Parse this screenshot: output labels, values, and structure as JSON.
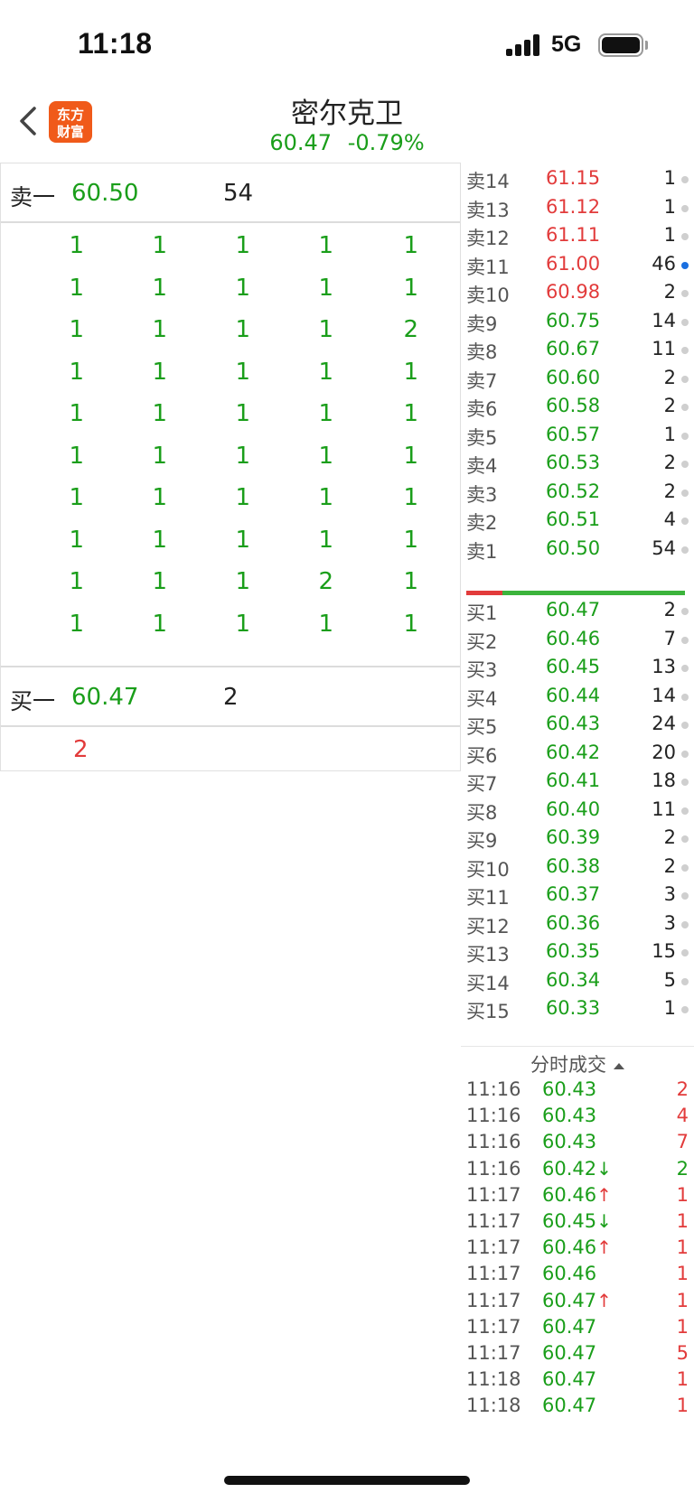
{
  "status_bar": {
    "time": "11:18",
    "network": "5G"
  },
  "header": {
    "logo_text": "东方财富",
    "stock_name": "密尔克卫",
    "price": "60.47",
    "change_pct": "-0.79%"
  },
  "left_panel": {
    "sell_level": {
      "label": "卖一",
      "price": "60.50",
      "volume": "54"
    },
    "sell_queue": [
      [
        "1",
        "1",
        "1",
        "1",
        "1"
      ],
      [
        "1",
        "1",
        "1",
        "1",
        "1"
      ],
      [
        "1",
        "1",
        "1",
        "1",
        "2"
      ],
      [
        "1",
        "1",
        "1",
        "1",
        "1"
      ],
      [
        "1",
        "1",
        "1",
        "1",
        "1"
      ],
      [
        "1",
        "1",
        "1",
        "1",
        "1"
      ],
      [
        "1",
        "1",
        "1",
        "1",
        "1"
      ],
      [
        "1",
        "1",
        "1",
        "1",
        "1"
      ],
      [
        "1",
        "1",
        "1",
        "2",
        "1"
      ],
      [
        "1",
        "1",
        "1",
        "1",
        "1"
      ]
    ],
    "buy_level": {
      "label": "买一",
      "price": "60.47",
      "volume": "2"
    },
    "buy_queue": [
      "2"
    ]
  },
  "order_book": {
    "asks": [
      {
        "label": "卖14",
        "price": "61.15",
        "volume": "1",
        "color": "red",
        "dot": "gray"
      },
      {
        "label": "卖13",
        "price": "61.12",
        "volume": "1",
        "color": "red",
        "dot": "gray"
      },
      {
        "label": "卖12",
        "price": "61.11",
        "volume": "1",
        "color": "red",
        "dot": "gray"
      },
      {
        "label": "卖11",
        "price": "61.00",
        "volume": "46",
        "color": "red",
        "dot": "blue"
      },
      {
        "label": "卖10",
        "price": "60.98",
        "volume": "2",
        "color": "red",
        "dot": "gray"
      },
      {
        "label": "卖9",
        "price": "60.75",
        "volume": "14",
        "color": "green",
        "dot": "gray"
      },
      {
        "label": "卖8",
        "price": "60.67",
        "volume": "11",
        "color": "green",
        "dot": "gray"
      },
      {
        "label": "卖7",
        "price": "60.60",
        "volume": "2",
        "color": "green",
        "dot": "gray"
      },
      {
        "label": "卖6",
        "price": "60.58",
        "volume": "2",
        "color": "green",
        "dot": "gray"
      },
      {
        "label": "卖5",
        "price": "60.57",
        "volume": "1",
        "color": "green",
        "dot": "gray"
      },
      {
        "label": "卖4",
        "price": "60.53",
        "volume": "2",
        "color": "green",
        "dot": "gray"
      },
      {
        "label": "卖3",
        "price": "60.52",
        "volume": "2",
        "color": "green",
        "dot": "gray"
      },
      {
        "label": "卖2",
        "price": "60.51",
        "volume": "4",
        "color": "green",
        "dot": "gray"
      },
      {
        "label": "卖1",
        "price": "60.50",
        "volume": "54",
        "color": "green",
        "dot": "gray"
      }
    ],
    "bids": [
      {
        "label": "买1",
        "price": "60.47",
        "volume": "2",
        "color": "green",
        "dot": "gray"
      },
      {
        "label": "买2",
        "price": "60.46",
        "volume": "7",
        "color": "green",
        "dot": "gray"
      },
      {
        "label": "买3",
        "price": "60.45",
        "volume": "13",
        "color": "green",
        "dot": "gray"
      },
      {
        "label": "买4",
        "price": "60.44",
        "volume": "14",
        "color": "green",
        "dot": "gray"
      },
      {
        "label": "买5",
        "price": "60.43",
        "volume": "24",
        "color": "green",
        "dot": "gray"
      },
      {
        "label": "买6",
        "price": "60.42",
        "volume": "20",
        "color": "green",
        "dot": "gray"
      },
      {
        "label": "买7",
        "price": "60.41",
        "volume": "18",
        "color": "green",
        "dot": "gray"
      },
      {
        "label": "买8",
        "price": "60.40",
        "volume": "11",
        "color": "green",
        "dot": "gray"
      },
      {
        "label": "买9",
        "price": "60.39",
        "volume": "2",
        "color": "green",
        "dot": "gray"
      },
      {
        "label": "买10",
        "price": "60.38",
        "volume": "2",
        "color": "green",
        "dot": "gray"
      },
      {
        "label": "买11",
        "price": "60.37",
        "volume": "3",
        "color": "green",
        "dot": "gray"
      },
      {
        "label": "买12",
        "price": "60.36",
        "volume": "3",
        "color": "green",
        "dot": "gray"
      },
      {
        "label": "买13",
        "price": "60.35",
        "volume": "15",
        "color": "green",
        "dot": "gray"
      },
      {
        "label": "买14",
        "price": "60.34",
        "volume": "5",
        "color": "green",
        "dot": "gray"
      },
      {
        "label": "买15",
        "price": "60.33",
        "volume": "1",
        "color": "green",
        "dot": "gray"
      }
    ]
  },
  "trades": {
    "title": "分时成交",
    "rows": [
      {
        "time": "11:16",
        "price": "60.43",
        "arrow": "",
        "volume": "2",
        "vol_color": "red"
      },
      {
        "time": "11:16",
        "price": "60.43",
        "arrow": "",
        "volume": "4",
        "vol_color": "red"
      },
      {
        "time": "11:16",
        "price": "60.43",
        "arrow": "",
        "volume": "7",
        "vol_color": "red"
      },
      {
        "time": "11:16",
        "price": "60.42",
        "arrow": "↓",
        "volume": "2",
        "vol_color": "green"
      },
      {
        "time": "11:17",
        "price": "60.46",
        "arrow": "↑",
        "volume": "1",
        "vol_color": "red"
      },
      {
        "time": "11:17",
        "price": "60.45",
        "arrow": "↓",
        "volume": "1",
        "vol_color": "red"
      },
      {
        "time": "11:17",
        "price": "60.46",
        "arrow": "↑",
        "volume": "1",
        "vol_color": "red"
      },
      {
        "time": "11:17",
        "price": "60.46",
        "arrow": "",
        "volume": "1",
        "vol_color": "red"
      },
      {
        "time": "11:17",
        "price": "60.47",
        "arrow": "↑",
        "volume": "1",
        "vol_color": "red"
      },
      {
        "time": "11:17",
        "price": "60.47",
        "arrow": "",
        "volume": "1",
        "vol_color": "red"
      },
      {
        "time": "11:17",
        "price": "60.47",
        "arrow": "",
        "volume": "5",
        "vol_color": "red"
      },
      {
        "time": "11:18",
        "price": "60.47",
        "arrow": "",
        "volume": "1",
        "vol_color": "red"
      },
      {
        "time": "11:18",
        "price": "60.47",
        "arrow": "",
        "volume": "1",
        "vol_color": "red"
      }
    ]
  },
  "colors": {
    "up": "#e23b3b",
    "down": "#1a9e1a",
    "accent_blue": "#1a6fe0",
    "logo": "#f05a1a"
  }
}
